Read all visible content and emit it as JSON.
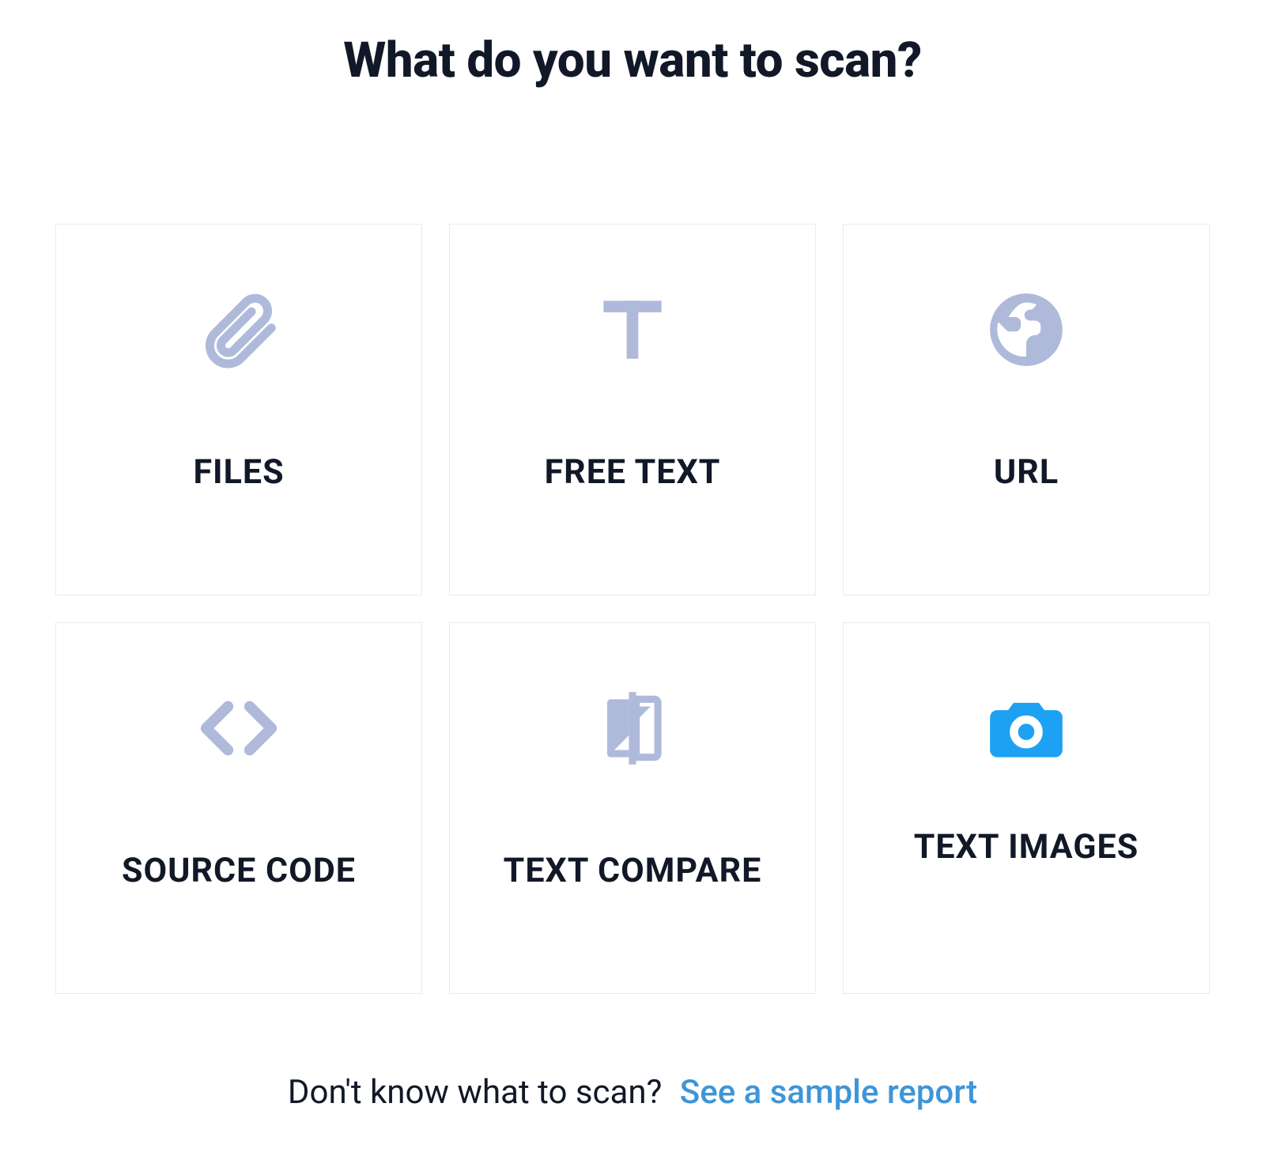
{
  "heading": "What do you want to scan?",
  "options": [
    {
      "label": "FILES",
      "icon": "paperclip-icon"
    },
    {
      "label": "FREE TEXT",
      "icon": "text-t-icon"
    },
    {
      "label": "URL",
      "icon": "globe-icon"
    },
    {
      "label": "SOURCE CODE",
      "icon": "code-brackets-icon"
    },
    {
      "label": "TEXT COMPARE",
      "icon": "compare-icon"
    },
    {
      "label": "TEXT IMAGES",
      "icon": "camera-icon"
    }
  ],
  "footer": {
    "prompt": "Don't know what to scan?",
    "link_label": "See a sample report"
  },
  "colors": {
    "icon_muted": "#AFBADB",
    "accent_blue": "#1DA1F2",
    "link_blue": "#3E95D7"
  }
}
